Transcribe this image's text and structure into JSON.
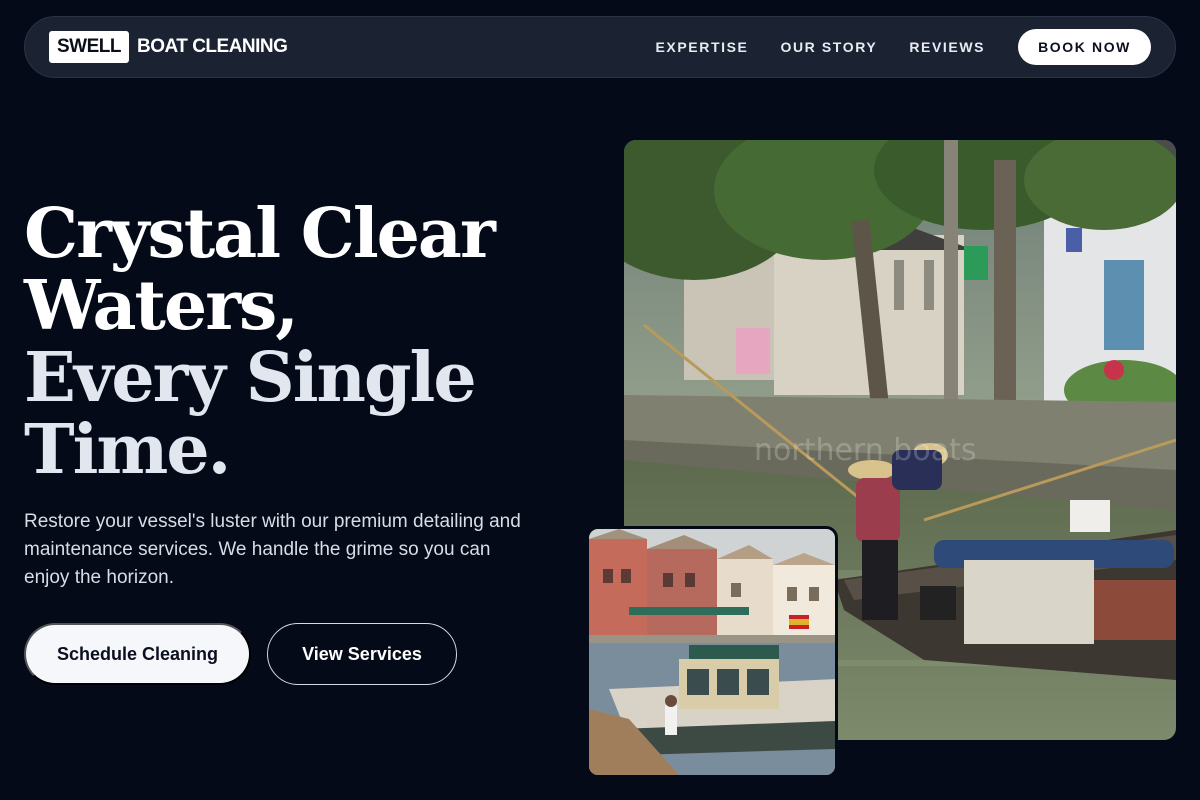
{
  "nav": {
    "brand_box": "SWELL",
    "brand_text": "BOAT CLEANING",
    "links": [
      "EXPERTISE",
      "OUR STORY",
      "REVIEWS"
    ],
    "cta": "BOOK NOW"
  },
  "hero": {
    "title_line1": "Crystal Clear",
    "title_line2": "Waters,",
    "title_line3": "Every Single",
    "title_line4": "Time.",
    "description": "Restore your vessel's luster with our premium detailing and maintenance services. We handle the grime so you can enjoy the horizon.",
    "primary_button": "Schedule Cleaning",
    "secondary_button": "View Services"
  },
  "images": {
    "large_photo_watermark": "northern boats"
  },
  "colors": {
    "background": "#040a18",
    "nav_background": "#1b2232",
    "button_light": "#f6f7fa"
  }
}
